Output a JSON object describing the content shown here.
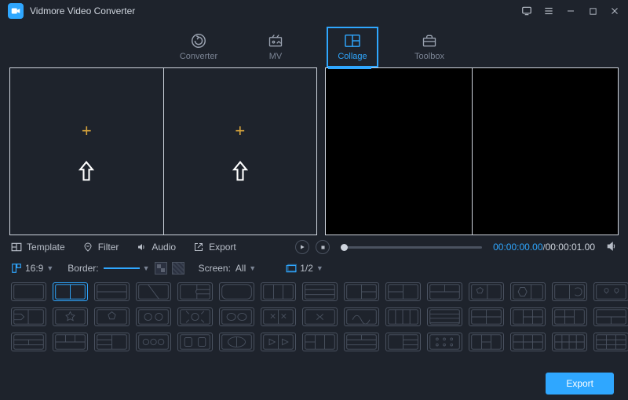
{
  "app": {
    "title": "Vidmore Video Converter"
  },
  "main_tabs": {
    "converter": "Converter",
    "mv": "MV",
    "collage": "Collage",
    "toolbox": "Toolbox",
    "active": "collage"
  },
  "subtabs": {
    "template": "Template",
    "filter": "Filter",
    "audio": "Audio",
    "export": "Export",
    "active": "template"
  },
  "playbar": {
    "current": "00:00:00.00",
    "total": "00:00:01.00"
  },
  "options": {
    "aspect_label": "16:9",
    "border_label": "Border:",
    "screen_label": "Screen:",
    "screen_value": "All",
    "screens_value": "1/2"
  },
  "buttons": {
    "export": "Export"
  }
}
